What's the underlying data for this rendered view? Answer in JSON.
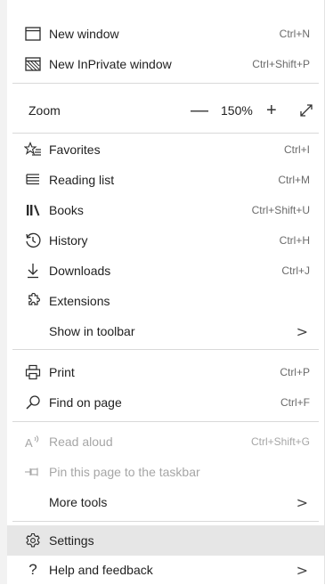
{
  "menu": {
    "new_window": {
      "label": "New window",
      "shortcut": "Ctrl+N",
      "icon": "window-icon"
    },
    "new_inprivate": {
      "label": "New InPrivate window",
      "shortcut": "Ctrl+Shift+P",
      "icon": "inprivate-icon"
    },
    "zoom": {
      "label": "Zoom",
      "minus": "—",
      "value": "150%",
      "plus": "+",
      "icon_full": "fullscreen-icon"
    },
    "favorites": {
      "label": "Favorites",
      "shortcut": "Ctrl+I",
      "icon": "favorites-icon"
    },
    "reading_list": {
      "label": "Reading list",
      "shortcut": "Ctrl+M",
      "icon": "reading-list-icon"
    },
    "books": {
      "label": "Books",
      "shortcut": "Ctrl+Shift+U",
      "icon": "books-icon"
    },
    "history": {
      "label": "History",
      "shortcut": "Ctrl+H",
      "icon": "history-icon"
    },
    "downloads": {
      "label": "Downloads",
      "shortcut": "Ctrl+J",
      "icon": "download-icon"
    },
    "extensions": {
      "label": "Extensions",
      "icon": "extensions-icon"
    },
    "show_in_toolbar": {
      "label": "Show in toolbar",
      "chevron": ">"
    },
    "print": {
      "label": "Print",
      "shortcut": "Ctrl+P",
      "icon": "print-icon"
    },
    "find_on_page": {
      "label": "Find on page",
      "shortcut": "Ctrl+F",
      "icon": "search-icon"
    },
    "read_aloud": {
      "label": "Read aloud",
      "shortcut": "Ctrl+Shift+G",
      "icon": "read-aloud-icon"
    },
    "pin_taskbar": {
      "label": "Pin this page to the taskbar",
      "icon": "pin-icon"
    },
    "more_tools": {
      "label": "More tools",
      "chevron": ">"
    },
    "settings": {
      "label": "Settings",
      "icon": "gear-icon"
    },
    "help": {
      "label": "Help and feedback",
      "icon": "question-icon",
      "chevron": ">"
    }
  },
  "colors": {
    "hover": "#e6e6e6",
    "disabled": "#a6a6a6",
    "text": "#1f1f1f"
  }
}
